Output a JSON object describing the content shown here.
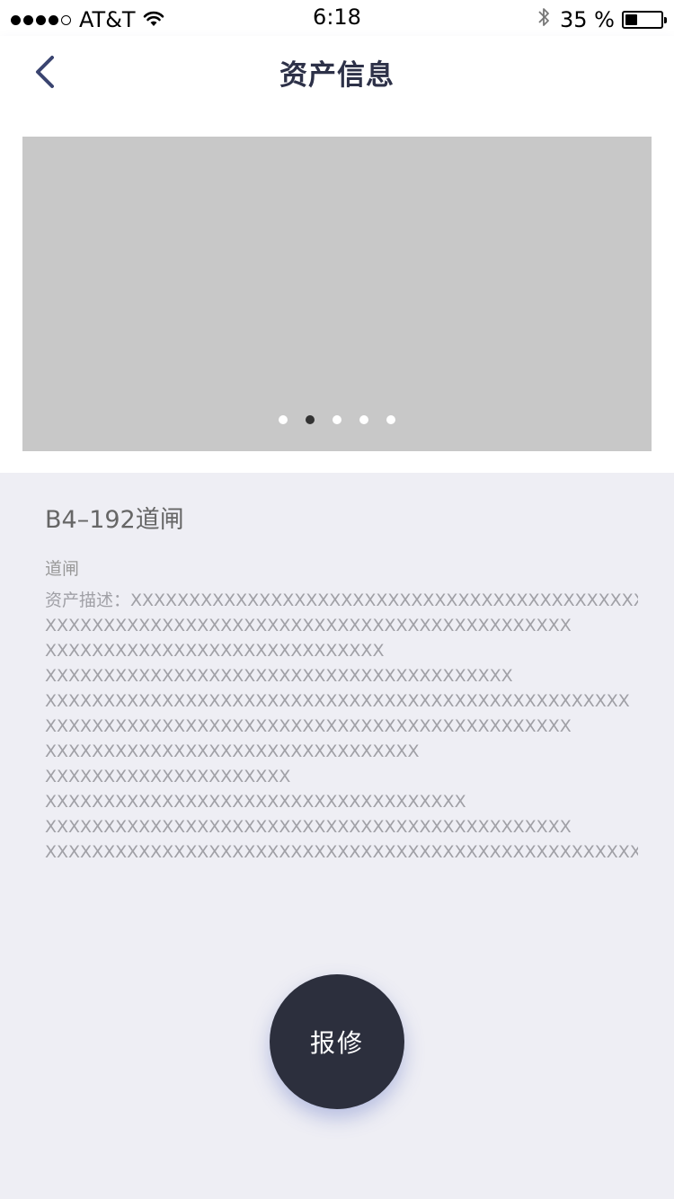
{
  "status_bar": {
    "carrier": "AT&T",
    "time": "6:18",
    "battery_text": "35 %",
    "battery_level": 0.35,
    "signal_bars_filled": 4,
    "signal_bars_total": 5,
    "icons": [
      "signal-dots-icon",
      "wifi-icon",
      "bluetooth-icon",
      "battery-icon"
    ]
  },
  "nav": {
    "title": "资产信息",
    "back_icon": "chevron-left-icon"
  },
  "gallery": {
    "page_count": 5,
    "active_index": 1
  },
  "asset": {
    "name": "B4–192道闸",
    "type": "道闸",
    "description_lines": [
      "资产描述：XXXXXXXXXXXXXXXXXXXXXXXXXXXXXXXXXXXXXXXXXXXXX",
      "XXXXXXXXXXXXXXXXXXXXXXXXXXXXXXXXXXXXXXXXXXXXX",
      "XXXXXXXXXXXXXXXXXXXXXXXXXXXXX",
      "XXXXXXXXXXXXXXXXXXXXXXXXXXXXXXXXXXXXXXXX",
      "XXXXXXXXXXXXXXXXXXXXXXXXXXXXXXXXXXXXXXXXXXXXXXXXXX",
      "XXXXXXXXXXXXXXXXXXXXXXXXXXXXXXXXXXXXXXXXXXXXX",
      "XXXXXXXXXXXXXXXXXXXXXXXXXXXXXXXX",
      "XXXXXXXXXXXXXXXXXXXXX",
      "XXXXXXXXXXXXXXXXXXXXXXXXXXXXXXXXXXXX",
      "XXXXXXXXXXXXXXXXXXXXXXXXXXXXXXXXXXXXXXXXXXXXX",
      "XXXXXXXXXXXXXXXXXXXXXXXXXXXXXXXXXXXXXXXXXXXXXXXXXXX"
    ]
  },
  "repair_button": {
    "label": "报修"
  },
  "colors": {
    "nav_title": "#2d3148",
    "back_chevron": "#3a4470",
    "page_background": "#eeeef4",
    "image_placeholder": "#c8c8c8",
    "button_background": "#2c2f3d",
    "active_dot": "#333333"
  }
}
